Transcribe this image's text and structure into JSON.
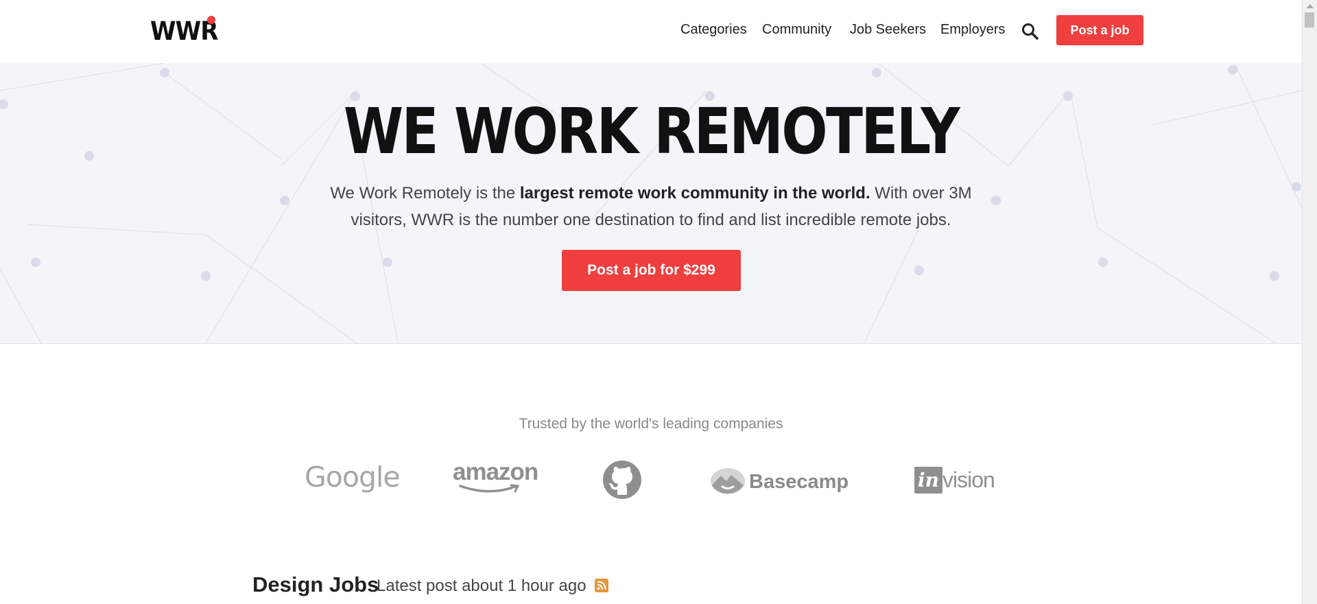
{
  "header": {
    "logo": "WWR",
    "nav": [
      "Categories",
      "Community",
      "Job Seekers",
      "Employers"
    ],
    "search_icon": "search-icon",
    "post_job_label": "Post a job"
  },
  "hero": {
    "title": "WE WORK REMOTELY",
    "text_1": "We Work Remotely is the ",
    "text_bold": "largest remote work community in the world.",
    "text_2": " With over 3M visitors, WWR is the number one destination to find and list incredible remote jobs.",
    "cta_label": "Post a job for $299"
  },
  "trusted": {
    "title": "Trusted by the world's leading companies",
    "companies": [
      "Google",
      "amazon",
      "GitHub",
      "Basecamp",
      "invision"
    ],
    "basecamp_label": "Basecamp",
    "invision_box": "in",
    "invision_text": "vision"
  },
  "section": {
    "title": "Design Jobs",
    "subtitle": "Latest post about 1 hour ago",
    "rss_icon": "rss-icon"
  },
  "colors": {
    "accent": "#ef3f3f",
    "hero_bg": "#f4f5f9",
    "rss": "#e6963b"
  }
}
